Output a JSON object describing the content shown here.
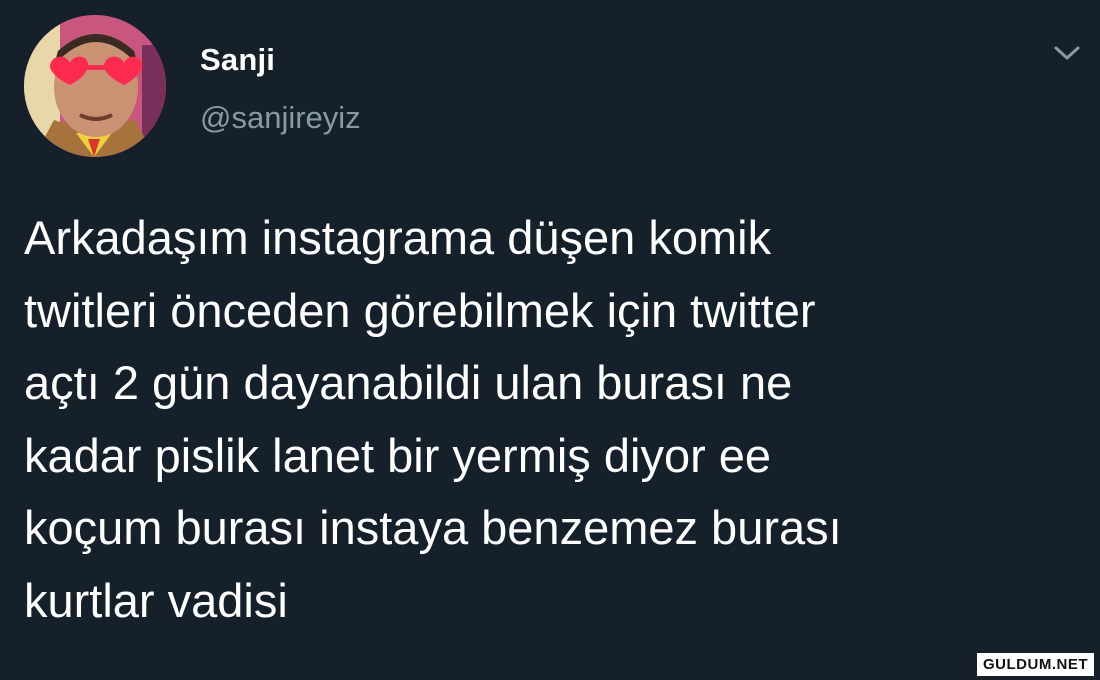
{
  "user": {
    "display_name": "Sanji",
    "handle": "@sanjireyiz",
    "avatar_icon": "profile-photo-icon"
  },
  "menu": {
    "icon": "chevron-down-icon"
  },
  "tweet": {
    "lines": [
      "Arkadaşım instagrama düşen komik",
      "twitleri önceden görebilmek için twitter",
      "açtı 2 gün dayanabildi ulan burası ne",
      "kadar pislik lanet bir yermiş diyor ee",
      "koçum burası instaya benzemez burası",
      "kurtlar vadisi"
    ]
  },
  "watermark": {
    "text": "GULDUM.NET"
  },
  "colors": {
    "background": "#15202b",
    "text_primary": "#ffffff",
    "text_secondary": "#8899a6"
  }
}
